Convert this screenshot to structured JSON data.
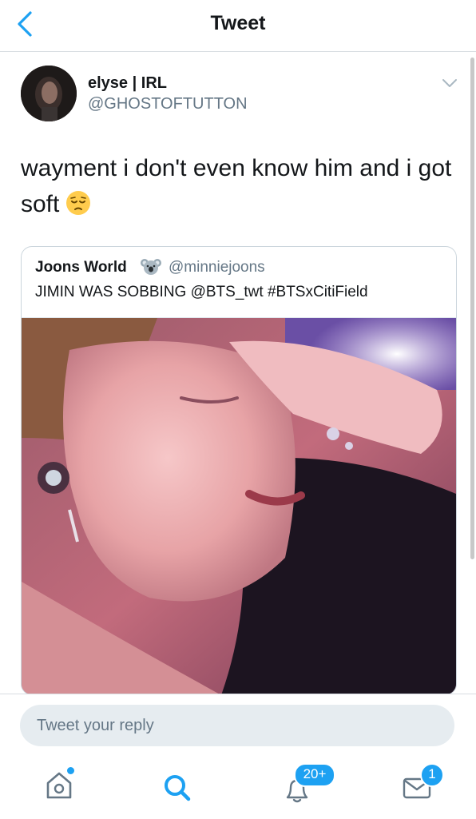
{
  "header": {
    "title": "Tweet",
    "back_icon": "chevron-left-icon"
  },
  "tweet": {
    "author_name": "elyse | IRL",
    "author_handle": "@GHOSTOFTUTTON",
    "text_line1": "wayment i don't even know him and i got",
    "text_line2": "soft",
    "emoji": "pensive-face-emoji"
  },
  "quoted_tweet": {
    "author_name": "Joons World",
    "author_emoji": "koala-emoji",
    "author_handle": "@minniejoons",
    "text": "JIMIN WAS SOBBING @BTS_twt #BTSxCitiField"
  },
  "reply": {
    "placeholder": "Tweet your reply"
  },
  "tabbar": {
    "home_icon": "home-icon",
    "search_icon": "search-icon",
    "notifications_icon": "bell-icon",
    "notifications_badge": "20+",
    "messages_icon": "envelope-icon",
    "messages_badge": "1"
  },
  "colors": {
    "accent": "#1da1f2",
    "text": "#14171a",
    "muted": "#657786",
    "border": "#ccd6dd"
  }
}
